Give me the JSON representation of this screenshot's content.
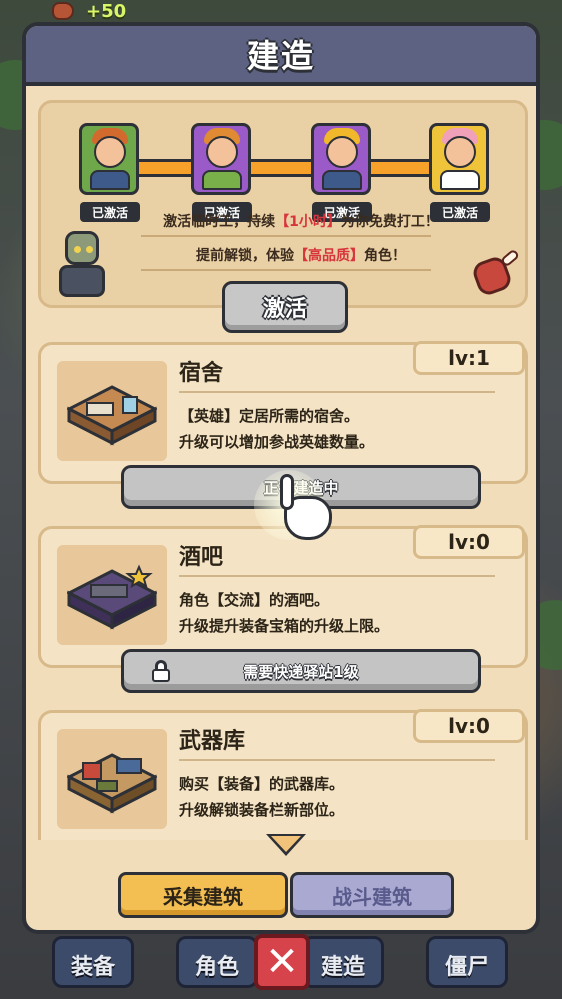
{
  "top_bar": {
    "resource_gain": "+50"
  },
  "panel": {
    "title": "建造"
  },
  "activation": {
    "heroes": [
      {
        "status": "已激活",
        "color": "#6fa84a"
      },
      {
        "status": "已激活",
        "color": "#9a5ac8"
      },
      {
        "status": "已激活",
        "color": "#9a5ac8"
      },
      {
        "status": "已激活",
        "color": "#f0c43a"
      }
    ],
    "line1_pre": "激活临时工，持续",
    "line1_hl": "【1小时】",
    "line1_post": "为你免费打工！",
    "line2_pre": "提前解锁，体验",
    "line2_hl": "【高品质】",
    "line2_post": "角色！",
    "button_label": "激活"
  },
  "buildings": [
    {
      "name": "宿舍",
      "level": "lv:1",
      "desc1": "【英雄】定居所需的宿舍。",
      "desc2": "升级可以增加参战英雄数量。",
      "button_label": "正在建造中"
    },
    {
      "name": "酒吧",
      "level": "lv:0",
      "desc1": "角色【交流】的酒吧。",
      "desc2": "升级提升装备宝箱的升级上限。",
      "button_label": "需要快递驿站1级"
    },
    {
      "name": "武器库",
      "level": "lv:0",
      "desc1": "购买【装备】的武器库。",
      "desc2": "升级解锁装备栏新部位。"
    }
  ],
  "tabs": {
    "active": "采集建筑",
    "idle": "战斗建筑"
  },
  "bottom_nav": [
    "装备",
    "角色",
    "建造",
    "僵尸"
  ]
}
